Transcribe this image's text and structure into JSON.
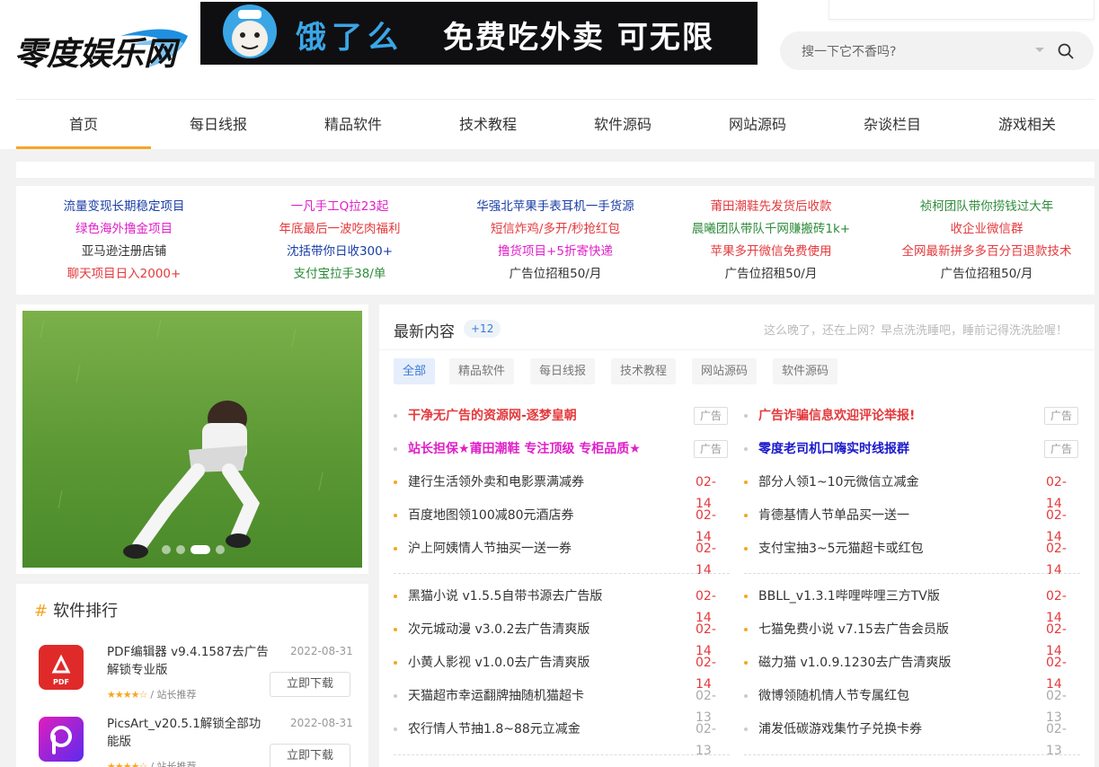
{
  "site": {
    "logo_text": "零度娱乐网"
  },
  "banner": {
    "text1": "饿了么",
    "text2": "免费吃外卖 可无限撸!"
  },
  "search": {
    "placeholder": "搜一下它不香吗?"
  },
  "nav": [
    {
      "label": "首页",
      "active": true
    },
    {
      "label": "每日线报"
    },
    {
      "label": "精品软件"
    },
    {
      "label": "技术教程"
    },
    {
      "label": "软件源码"
    },
    {
      "label": "网站源码"
    },
    {
      "label": "杂谈栏目"
    },
    {
      "label": "游戏相关"
    }
  ],
  "colors": {
    "accent": "#f5a623",
    "red": "#e4393c",
    "blue": "#3a7bd5"
  },
  "ads": [
    [
      {
        "text": "流量变现长期稳定项目",
        "color": "#1a3ea6"
      },
      {
        "text": "一凡手工Q拉23起",
        "color": "#e020c8"
      },
      {
        "text": "华强北苹果手表耳机一手货源",
        "color": "#1a3ea6"
      },
      {
        "text": "莆田潮鞋先发货后收款",
        "color": "#e4393c"
      },
      {
        "text": "祯柯团队带你捞钱过大年",
        "color": "#2e8b3a"
      }
    ],
    [
      {
        "text": "绿色海外撸金项目",
        "color": "#e020c8"
      },
      {
        "text": "年底最后一波吃肉福利",
        "color": "#e4393c"
      },
      {
        "text": "短信炸鸡/多开/秒抢红包",
        "color": "#e4393c"
      },
      {
        "text": "晨曦团队带队千网赚搬砖1k+",
        "color": "#2e8b3a"
      },
      {
        "text": "收企业微信群",
        "color": "#e4393c"
      }
    ],
    [
      {
        "text": "亚马逊注册店铺",
        "color": "#333333"
      },
      {
        "text": "沈括带你日收300+",
        "color": "#1a3ea6"
      },
      {
        "text": "撸货项目+5折寄快递",
        "color": "#e020c8"
      },
      {
        "text": "苹果多开微信免费使用",
        "color": "#e4393c"
      },
      {
        "text": "全网最新拼多多百分百退款技术",
        "color": "#e4393c"
      }
    ],
    [
      {
        "text": "聊天项目日入2000+",
        "color": "#e4393c"
      },
      {
        "text": "支付宝拉手38/单",
        "color": "#2e8b3a"
      },
      {
        "text": "广告位招租50/月",
        "color": "#333333"
      },
      {
        "text": "广告位招租50/月",
        "color": "#333333"
      },
      {
        "text": "广告位招租50/月",
        "color": "#333333"
      }
    ]
  ],
  "slider": {
    "dots": 4,
    "active_dot": 2
  },
  "ranking": {
    "title": "软件排行",
    "items": [
      {
        "name": "PDF编辑器 v9.4.1587去广告解锁专业版",
        "date": "2022-08-31",
        "stars": "★★★★☆",
        "tag": "/ 站长推荐",
        "button": "立即下载",
        "icon": "pdf-app-icon"
      },
      {
        "name": "PicsArt_v20.5.1解锁全部功能版",
        "date": "2022-08-31",
        "stars": "★★★★☆",
        "tag": "/ 站长推荐",
        "button": "立即下载",
        "icon": "picsart-app-icon"
      }
    ]
  },
  "latest": {
    "title": "最新内容",
    "count": "+12",
    "note": "这么晚了，还在上网？早点洗洗睡吧，睡前记得洗洗脸喔！",
    "filters": [
      "全部",
      "精品软件",
      "每日线报",
      "技术教程",
      "网站源码",
      "软件源码"
    ],
    "pinned_left": [
      {
        "text": "干净无广告的资源网-逐梦皇朝",
        "color": "#e4393c",
        "tag": "广告"
      },
      {
        "text": "站长担保★莆田潮鞋 专注顶级 专柜品质★",
        "color": "#e020c8",
        "tag": "广告"
      }
    ],
    "pinned_right": [
      {
        "text": "广告诈骗信息欢迎评论举报!",
        "color": "#e4393c",
        "tag": "广告"
      },
      {
        "text": "零度老司机口嗨实时线报群",
        "color": "#1a1acc",
        "tag": "广告"
      }
    ],
    "group1_left": [
      {
        "text": "建行生活领外卖和电影票满减券",
        "date": "02-14"
      },
      {
        "text": "百度地图领100减80元酒店券",
        "date": "02-14"
      },
      {
        "text": "沪上阿姨情人节抽买一送一券",
        "date": "02-14"
      }
    ],
    "group1_right": [
      {
        "text": "部分人领1~10元微信立减金",
        "date": "02-14"
      },
      {
        "text": "肯德基情人节单品买一送一",
        "date": "02-14"
      },
      {
        "text": "支付宝抽3~5元猫超卡或红包",
        "date": "02-14"
      }
    ],
    "group2_left": [
      {
        "text": "黑猫小说 v1.5.5自带书源去广告版",
        "date": "02-14",
        "hot": true
      },
      {
        "text": "次元城动漫 v3.0.2去广告清爽版",
        "date": "02-14",
        "hot": true
      },
      {
        "text": "小黄人影视 v1.0.0去广告清爽版",
        "date": "02-14",
        "hot": true
      },
      {
        "text": "天猫超市幸运翻牌抽随机猫超卡",
        "date": "02-13",
        "hot": false
      },
      {
        "text": "农行情人节抽1.8~88元立减金",
        "date": "02-13",
        "hot": false
      }
    ],
    "group2_right": [
      {
        "text": "BBLL_v1.3.1哔哩哔哩三方TV版",
        "date": "02-14",
        "hot": true
      },
      {
        "text": "七猫免费小说 v7.15去广告会员版",
        "date": "02-14",
        "hot": true
      },
      {
        "text": "磁力猫 v1.0.9.1230去广告清爽版",
        "date": "02-14",
        "hot": true
      },
      {
        "text": "微博领随机情人节专属红包",
        "date": "02-13",
        "hot": false
      },
      {
        "text": "浦发低碳游戏集竹子兑换卡券",
        "date": "02-13",
        "hot": false
      }
    ]
  }
}
